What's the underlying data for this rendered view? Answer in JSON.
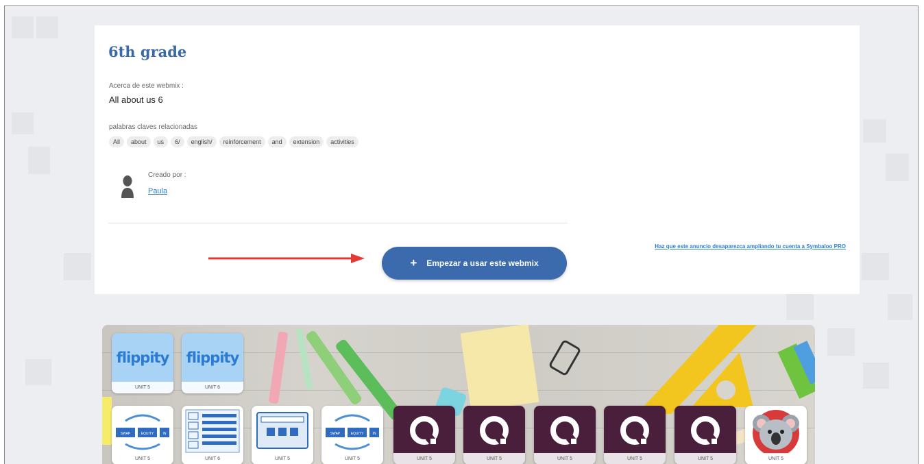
{
  "webmix": {
    "title": "6th grade",
    "about_label": "Acerca de este webmix :",
    "about_value": "All about us 6",
    "keywords_label": "palabras claves relacionadas",
    "keywords": [
      "All",
      "about",
      "us",
      "6/",
      "english/",
      "reinforcement",
      "and",
      "extension",
      "activities"
    ],
    "created_by_label": "Creado por :",
    "author": "Paula",
    "start_button": "Empezar a usar este webmix",
    "pro_link": "Haz que este anuncio desaparezca ampliando tu cuenta a Symbaloo PRO"
  },
  "colors": {
    "title": "#3b68a6",
    "button": "#3b6aad",
    "arrow": "#e53935",
    "link": "#2f7fd4",
    "quizizz": "#4a1f3c"
  },
  "tiles": {
    "row1": [
      {
        "label": "UNIT 5",
        "icon": "flippity-logo-icon",
        "text": "flippity"
      },
      {
        "label": "UNIT 6",
        "icon": "flippity-logo-icon",
        "text": "flippity"
      }
    ],
    "row2": [
      {
        "label": "UNIT 5",
        "icon": "swap-equation-icon",
        "words": [
          "SWAP",
          "EQUITY",
          "IN"
        ]
      },
      {
        "label": "UNIT 6",
        "icon": "worksheet-grid-icon"
      },
      {
        "label": "UNIT 5",
        "icon": "board-game-icon"
      },
      {
        "label": "UNIT 5",
        "icon": "swap-equation-icon",
        "words": [
          "SWAP",
          "EQUITY",
          "IN"
        ]
      },
      {
        "label": "UNIT 5",
        "icon": "quizizz-logo-icon"
      },
      {
        "label": "UNIT 5",
        "icon": "quizizz-logo-icon"
      },
      {
        "label": "UNIT 5",
        "icon": "quizizz-logo-icon"
      },
      {
        "label": "UNIT 5",
        "icon": "quizizz-logo-icon"
      },
      {
        "label": "UNIT 5",
        "icon": "quizizz-logo-icon"
      },
      {
        "label": "UNIT 5",
        "icon": "koala-icon"
      }
    ]
  }
}
